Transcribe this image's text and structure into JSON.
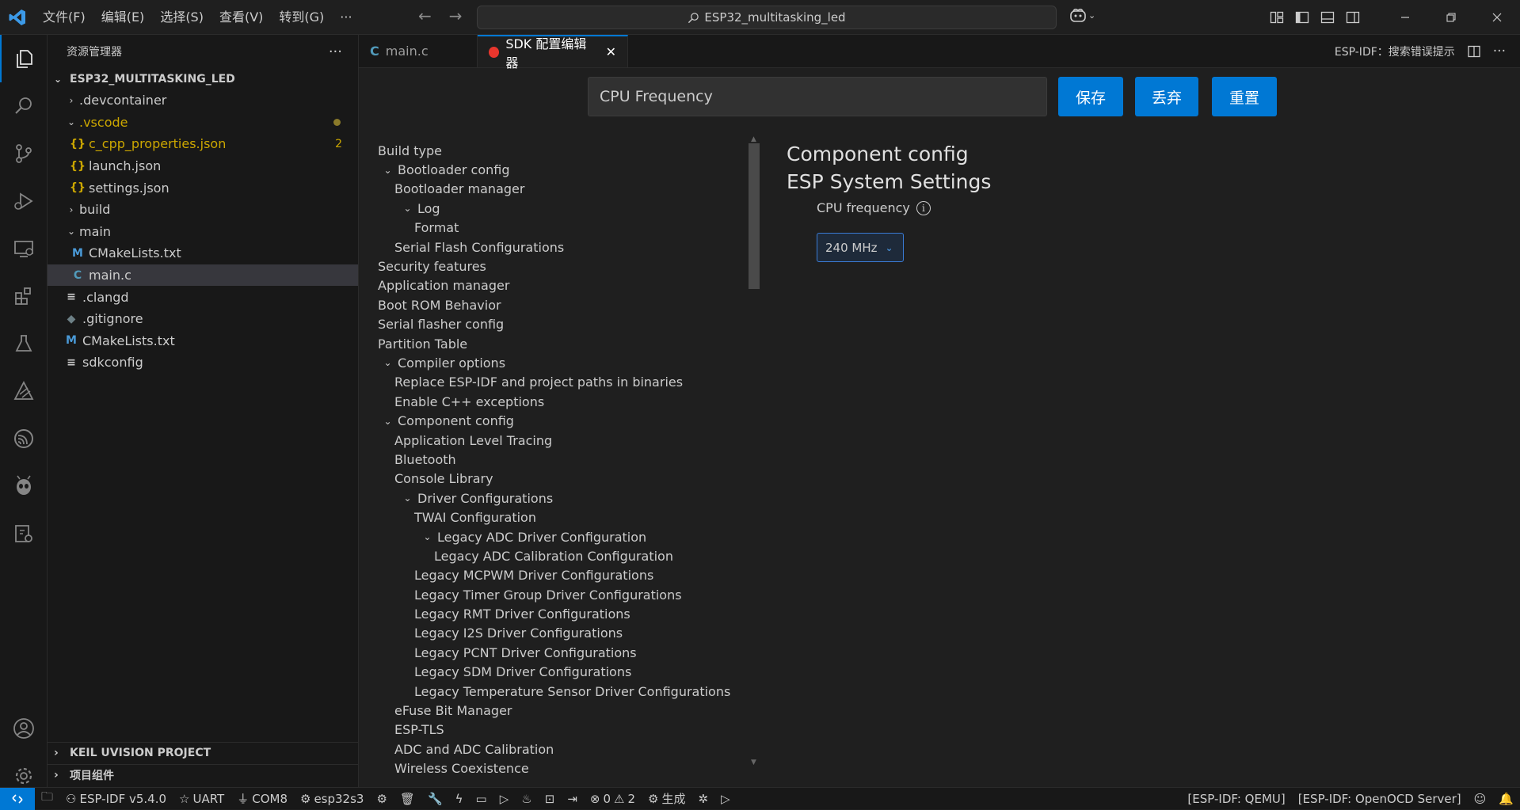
{
  "menu": [
    "文件(F)",
    "编辑(E)",
    "选择(S)",
    "查看(V)",
    "转到(G)",
    "···"
  ],
  "command_center": "ESP32_multitasking_led",
  "sidebar": {
    "title": "资源管理器",
    "root": "ESP32_MULTITASKING_LED",
    "items": [
      {
        "label": ".devcontainer",
        "type": "folder",
        "expanded": false
      },
      {
        "label": ".vscode",
        "type": "folder",
        "expanded": true
      },
      {
        "label": "c_cpp_properties.json",
        "type": "json",
        "badge": "2"
      },
      {
        "label": "launch.json",
        "type": "json"
      },
      {
        "label": "settings.json",
        "type": "json"
      },
      {
        "label": "build",
        "type": "folder",
        "expanded": false
      },
      {
        "label": "main",
        "type": "folder",
        "expanded": true
      },
      {
        "label": "CMakeLists.txt",
        "type": "cmake"
      },
      {
        "label": "main.c",
        "type": "c"
      },
      {
        "label": ".clangd",
        "type": "text"
      },
      {
        "label": ".gitignore",
        "type": "git"
      },
      {
        "label": "CMakeLists.txt",
        "type": "cmake"
      },
      {
        "label": "sdkconfig",
        "type": "text"
      }
    ],
    "bottom_sections": [
      "KEIL UVISION PROJECT",
      "项目组件"
    ]
  },
  "tabs": [
    {
      "label": "main.c",
      "active": false
    },
    {
      "label": "SDK 配置编辑器",
      "active": true
    }
  ],
  "tab_right_label": "ESP-IDF：搜索错误提示",
  "search": {
    "value": "CPU Frequency"
  },
  "buttons": {
    "save": "保存",
    "discard": "丢弃",
    "reset": "重置"
  },
  "config_tree": [
    {
      "label": "Build type",
      "level": 0,
      "chevron": false
    },
    {
      "label": "Bootloader config",
      "level": 0,
      "chevron": true
    },
    {
      "label": "Bootloader manager",
      "level": 1,
      "chevron": false
    },
    {
      "label": "Log",
      "level": 1,
      "chevron": true
    },
    {
      "label": "Format",
      "level": 2,
      "chevron": false
    },
    {
      "label": "Serial Flash Configurations",
      "level": 1,
      "chevron": false
    },
    {
      "label": "Security features",
      "level": 0,
      "chevron": false
    },
    {
      "label": "Application manager",
      "level": 0,
      "chevron": false
    },
    {
      "label": "Boot ROM Behavior",
      "level": 0,
      "chevron": false
    },
    {
      "label": "Serial flasher config",
      "level": 0,
      "chevron": false
    },
    {
      "label": "Partition Table",
      "level": 0,
      "chevron": false
    },
    {
      "label": "Compiler options",
      "level": 0,
      "chevron": true
    },
    {
      "label": "Replace ESP-IDF and project paths in binaries",
      "level": 1,
      "chevron": false
    },
    {
      "label": "Enable C++ exceptions",
      "level": 1,
      "chevron": false
    },
    {
      "label": "Component config",
      "level": 0,
      "chevron": true
    },
    {
      "label": "Application Level Tracing",
      "level": 1,
      "chevron": false
    },
    {
      "label": "Bluetooth",
      "level": 1,
      "chevron": false
    },
    {
      "label": "Console Library",
      "level": 1,
      "chevron": false
    },
    {
      "label": "Driver Configurations",
      "level": 1,
      "chevron": true
    },
    {
      "label": "TWAI Configuration",
      "level": 2,
      "chevron": false
    },
    {
      "label": "Legacy ADC Driver Configuration",
      "level": 2,
      "chevron": true
    },
    {
      "label": "Legacy ADC Calibration Configuration",
      "level": 3,
      "chevron": false
    },
    {
      "label": "Legacy MCPWM Driver Configurations",
      "level": 2,
      "chevron": false
    },
    {
      "label": "Legacy Timer Group Driver Configurations",
      "level": 2,
      "chevron": false
    },
    {
      "label": "Legacy RMT Driver Configurations",
      "level": 2,
      "chevron": false
    },
    {
      "label": "Legacy I2S Driver Configurations",
      "level": 2,
      "chevron": false
    },
    {
      "label": "Legacy PCNT Driver Configurations",
      "level": 2,
      "chevron": false
    },
    {
      "label": "Legacy SDM Driver Configurations",
      "level": 2,
      "chevron": false
    },
    {
      "label": "Legacy Temperature Sensor Driver Configurations",
      "level": 2,
      "chevron": false
    },
    {
      "label": "eFuse Bit Manager",
      "level": 1,
      "chevron": false
    },
    {
      "label": "ESP-TLS",
      "level": 1,
      "chevron": false
    },
    {
      "label": "ADC and ADC Calibration",
      "level": 1,
      "chevron": false
    },
    {
      "label": "Wireless Coexistence",
      "level": 1,
      "chevron": false
    }
  ],
  "detail": {
    "heading1": "Component config",
    "heading2": "ESP System Settings",
    "field_label": "CPU frequency",
    "field_value": "240 MHz"
  },
  "statusbar": {
    "left": [
      {
        "icon": "robot-icon",
        "label": "ESP-IDF v5.4.0"
      },
      {
        "icon": "star-icon",
        "label": "UART"
      },
      {
        "icon": "plug-icon",
        "label": "COM8"
      },
      {
        "icon": "chip-icon",
        "label": "esp32s3"
      }
    ],
    "errors": "0",
    "warnings": "2",
    "build_label": "生成",
    "right": [
      "[ESP-IDF: QEMU]",
      "[ESP-IDF: OpenOCD Server]"
    ]
  },
  "colors": {
    "accent": "#0078d4",
    "warning_yellow": "#cca700"
  }
}
